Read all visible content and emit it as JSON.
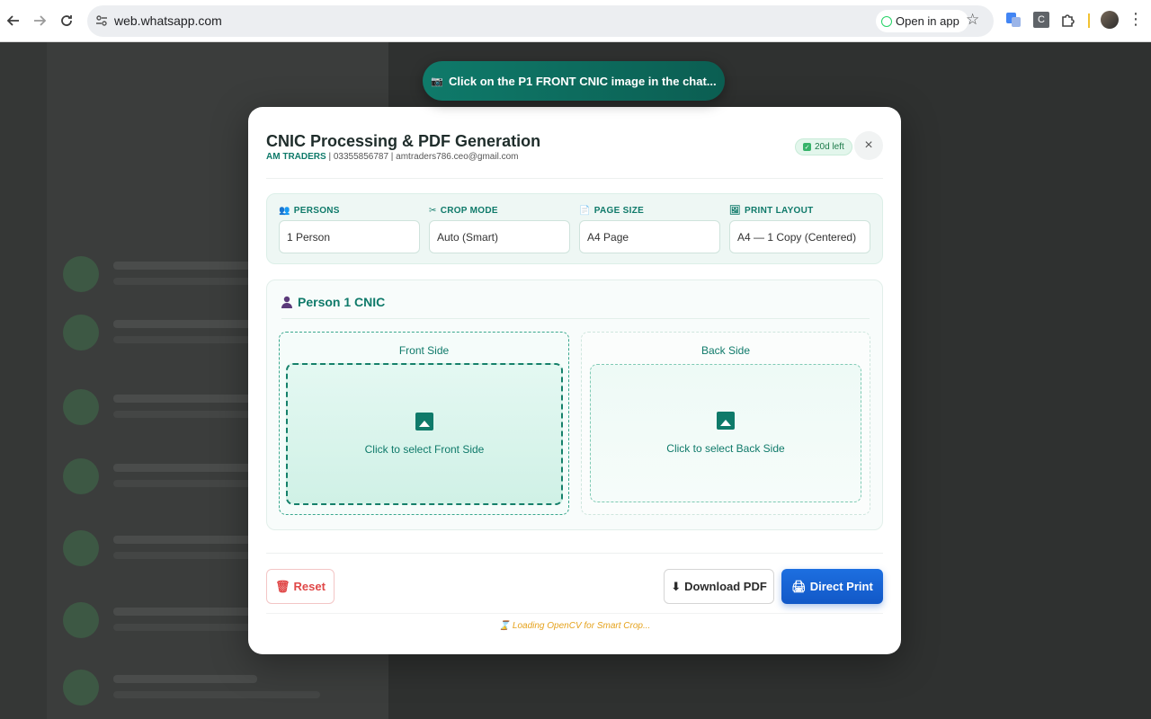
{
  "browser": {
    "url": "web.whatsapp.com",
    "open_in_app": "Open in app",
    "ext_c_label": "C"
  },
  "toast": {
    "text": "Click on the P1 FRONT CNIC image in the chat...",
    "icon": "camera-icon"
  },
  "modal": {
    "title": "CNIC Processing & PDF Generation",
    "brand": "AM TRADERS",
    "contact": " | 03355856787 | amtraders786.ceo@gmail.com",
    "badge": "20d left",
    "close": "×",
    "settings": [
      {
        "label": "PERSONS",
        "value": "1 Person",
        "icon": "people-icon"
      },
      {
        "label": "CROP MODE",
        "value": "Auto (Smart)",
        "icon": "scissors-icon"
      },
      {
        "label": "PAGE SIZE",
        "value": "A4 Page",
        "icon": "page-icon"
      },
      {
        "label": "PRINT LAYOUT",
        "value": "A4 — 1 Copy (Centered)",
        "icon": "layout-icon"
      }
    ],
    "person": {
      "title": "Person 1 CNIC",
      "front_title": "Front Side",
      "front_prompt": "Click to select Front Side",
      "back_title": "Back Side",
      "back_prompt": "Click to select Back Side"
    },
    "buttons": {
      "reset": "Reset",
      "download": "Download PDF",
      "print": "Direct Print"
    },
    "loading": "Loading OpenCV for Smart Crop..."
  },
  "colors": {
    "accent": "#0f7a6a",
    "print_button": "#1d6fe0",
    "reset_text": "#e04848",
    "loading_text": "#e5a21c"
  }
}
